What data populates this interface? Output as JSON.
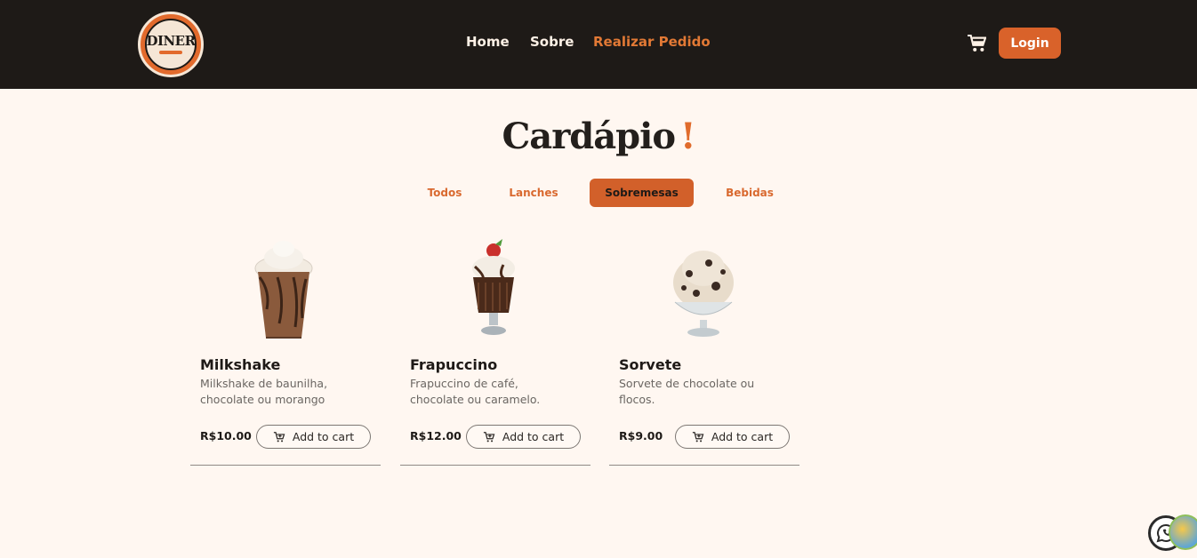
{
  "header": {
    "logo_text": "DINER",
    "nav": [
      {
        "label": "Home",
        "active": false
      },
      {
        "label": "Sobre",
        "active": false
      },
      {
        "label": "Realizar Pedido",
        "active": true
      }
    ],
    "cart_icon": "cart-icon",
    "login_label": "Login"
  },
  "title": {
    "text": "Cardápio",
    "accent": "!"
  },
  "tabs": [
    {
      "label": "Todos",
      "active": false
    },
    {
      "label": "Lanches",
      "active": false
    },
    {
      "label": "Sobremesas",
      "active": true
    },
    {
      "label": "Bebidas",
      "active": false
    }
  ],
  "products": [
    {
      "name": "Milkshake",
      "description": "Milkshake de baunilha, chocolate ou morango",
      "price": "R$10.00",
      "button": "Add to cart",
      "image": "milkshake-image"
    },
    {
      "name": "Frapuccino",
      "description": "Frapuccino de café, chocolate ou caramelo.",
      "price": "R$12.00",
      "button": "Add to cart",
      "image": "frapuccino-image"
    },
    {
      "name": "Sorvete",
      "description": "Sorvete de chocolate ou flocos.",
      "price": "R$9.00",
      "button": "Add to cart",
      "image": "sorvete-image"
    }
  ],
  "colors": {
    "header_bg": "#1e1a17",
    "accent": "#d9622a",
    "page_bg": "#fff7f1"
  }
}
